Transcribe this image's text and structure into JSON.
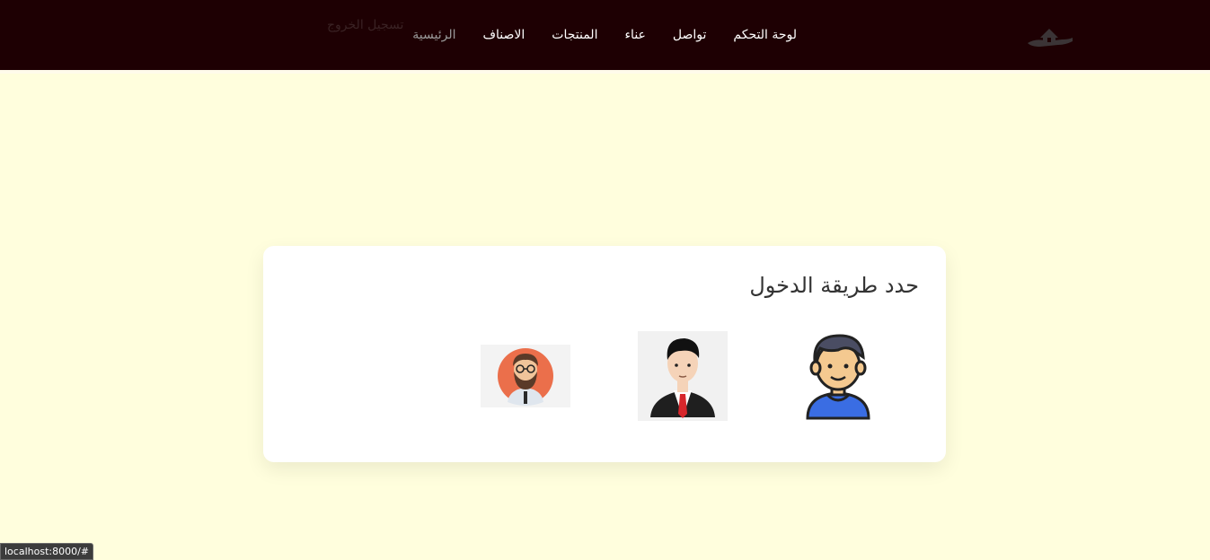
{
  "nav": {
    "links": [
      {
        "label": "الرئيسية",
        "active": true
      },
      {
        "label": "الاصناف",
        "active": false
      },
      {
        "label": "المنتجات",
        "active": false
      },
      {
        "label": "عناء",
        "active": false
      },
      {
        "label": "تواصل",
        "active": false
      },
      {
        "label": "لوحة التحكم",
        "active": false
      }
    ],
    "logout_label": "تسجيل الخروج",
    "logo_icon": "house-in-hand-icon"
  },
  "card": {
    "title": "حدد طريقة الدخول",
    "options": [
      {
        "name": "user",
        "icon": "user-avatar-icon"
      },
      {
        "name": "business",
        "icon": "businessman-avatar-icon"
      },
      {
        "name": "admin",
        "icon": "bearded-man-avatar-icon"
      }
    ]
  },
  "status_bar": {
    "url": "localhost:8000/#"
  },
  "colors": {
    "navbar": "#1e0003",
    "page_bg": "#fffedd",
    "card_bg": "#ffffff"
  }
}
